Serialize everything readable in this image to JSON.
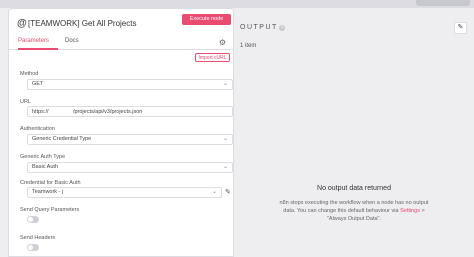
{
  "node": {
    "icon": "at-icon",
    "title": "[TEAMWORK] Get All Projects",
    "execute_label": "Execute node"
  },
  "tabs": [
    {
      "label": "Parameters",
      "active": true
    },
    {
      "label": "Docs",
      "active": false
    }
  ],
  "import_curl_label": "Import cURL",
  "fields": {
    "method": {
      "label": "Method",
      "value": "GET"
    },
    "url": {
      "label": "URL",
      "value": "https://                /projects/api/v3/projects.json"
    },
    "authentication": {
      "label": "Authentication",
      "value": "Generic Credential Type"
    },
    "generic_auth_type": {
      "label": "Generic Auth Type",
      "value": "Basic Auth"
    },
    "credential": {
      "label": "Credential for Basic Auth",
      "value": "Teamwork - j"
    },
    "send_query": {
      "label": "Send Query Parameters",
      "on": false
    },
    "send_headers": {
      "label": "Send Headers",
      "on": false
    }
  },
  "output": {
    "title": "OUTPUT",
    "item_count": "1 item",
    "empty_title": "No output data returned",
    "empty_desc_1": "n8n stops executing the workflow when a node has no output data. You can change this default behaviour via ",
    "empty_link": "Settings",
    "empty_desc_2": " > \"Always Output Data\"."
  },
  "colors": {
    "accent": "#ea4b71",
    "background": "#eeeef0"
  }
}
